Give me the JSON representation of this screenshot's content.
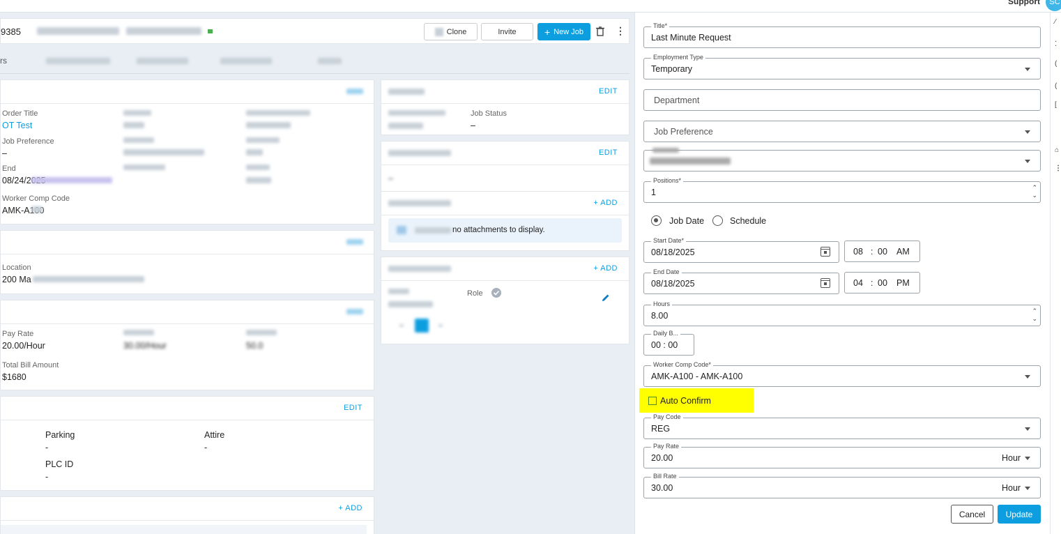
{
  "topbar": {
    "support": "Support",
    "avatar": "SC"
  },
  "header": {
    "job_id": "9385",
    "clone": "Clone",
    "invite": "Invite",
    "new_job": "New Job"
  },
  "order_card": {
    "order_title_label": "Order Title",
    "order_title_value": "OT Test",
    "job_pref_label": "Job Preference",
    "job_pref_value": "–",
    "end_label": "End",
    "end_value": "08/24/2025",
    "worker_comp_label": "Worker Comp Code",
    "worker_comp_value": "AMK-A100"
  },
  "location_card": {
    "label": "Location",
    "value": "200 Ma"
  },
  "pay_card": {
    "pay_rate_label": "Pay Rate",
    "pay_rate_value": "20.00/Hour",
    "bill_rate_value": "30.00/Hour",
    "markup_value": "50.0",
    "total_label": "Total Bill Amount",
    "total_value": "$1680"
  },
  "misc_card": {
    "edit": "EDIT",
    "parking_label": "Parking",
    "parking_value": "-",
    "attire_label": "Attire",
    "attire_value": "-",
    "plc_label": "PLC ID",
    "plc_value": "-"
  },
  "bottom_card": {
    "add": "+ ADD"
  },
  "side": {
    "edit": "EDIT",
    "add": "+ ADD",
    "job_status_label": "Job Status",
    "job_status_value": "–",
    "dash": "–",
    "no_attach": "no attachments to display.",
    "role_label": "Role"
  },
  "form": {
    "title_label": "Title*",
    "title_value": "Last Minute Request",
    "emp_type_label": "Employment Type",
    "emp_type_value": "Temporary",
    "department_placeholder": "Department",
    "job_pref_placeholder": "Job Preference",
    "positions_label": "Positions*",
    "positions_value": "1",
    "radio_job_date": "Job Date",
    "radio_schedule": "Schedule",
    "start_date_label": "Start Date*",
    "start_date_value": "08/18/2025",
    "start_hour": "08",
    "start_min": "00",
    "start_ampm": "AM",
    "end_date_label": "End Date",
    "end_date_value": "08/18/2025",
    "end_hour": "04",
    "end_min": "00",
    "end_ampm": "PM",
    "hours_label": "Hours",
    "hours_value": "8.00",
    "daily_break_label": "Daily B...",
    "daily_break_value": "00 : 00",
    "worker_comp_label": "Worker Comp Code*",
    "worker_comp_value": "AMK-A100 - AMK-A100",
    "auto_confirm": "Auto Confirm",
    "pay_code_label": "Pay Code",
    "pay_code_value": "REG",
    "pay_rate_label": "Pay Rate",
    "pay_rate_value": "20.00",
    "pay_rate_unit": "Hour",
    "bill_rate_label": "Bill Rate",
    "bill_rate_value": "30.00",
    "bill_rate_unit": "Hour",
    "cancel": "Cancel",
    "update": "Update"
  },
  "colors": {
    "accent": "#0d9ee0",
    "highlight": "#ffff00"
  }
}
